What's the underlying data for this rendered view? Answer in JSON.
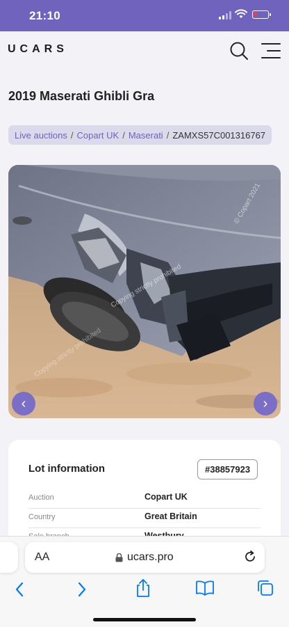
{
  "status_bar": {
    "time": "21:10"
  },
  "header": {
    "logo": "UCARS"
  },
  "page": {
    "title": "2019 Maserati Ghibli Gra"
  },
  "breadcrumb": {
    "items": [
      "Live auctions",
      "Copart UK",
      "Maserati"
    ],
    "current": "ZAMXS57C001316767",
    "separator": "/"
  },
  "gallery": {
    "watermark_1": "© Copart 2021",
    "watermark_2": "Copying strictly prohibited"
  },
  "lot_info": {
    "title": "Lot information",
    "lot_number": "#38857923",
    "rows": [
      {
        "label": "Auction",
        "value": "Copart UK"
      },
      {
        "label": "Country",
        "value": "Great Britain"
      },
      {
        "label": "Sale branch",
        "value": "Westbury"
      }
    ]
  },
  "browser": {
    "aa_label": "AA",
    "url": "ucars.pro"
  },
  "colors": {
    "accent": "#6f63bd",
    "status_bar": "#6f63bd",
    "battery_low": "#ff3b30",
    "link": "#007aff"
  }
}
